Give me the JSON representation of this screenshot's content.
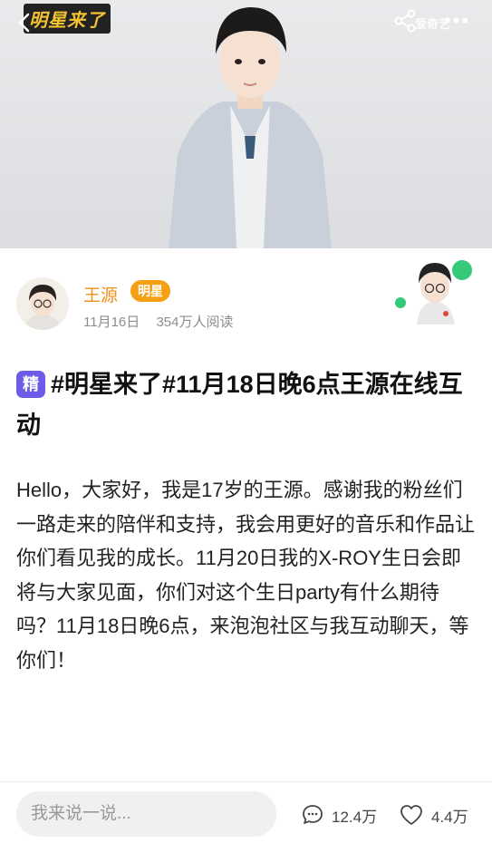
{
  "hero": {
    "logo_text": "明星来了",
    "brand": "爱奇艺",
    "more_glyph": "•••"
  },
  "author": {
    "name": "王源",
    "badge": "明星",
    "date": "11月16日",
    "reads": "354万人阅读"
  },
  "post": {
    "tag": "精",
    "title": "#明星来了#11月18日晚6点王源在线互动",
    "body": "Hello，大家好，我是17岁的王源。感谢我的粉丝们一路走来的陪伴和支持，我会用更好的音乐和作品让你们看见我的成长。11月20日我的X-ROY生日会即将与大家见面，你们对这个生日party有什么期待吗？11月18日晚6点，来泡泡社区与我互动聊天，等你们！"
  },
  "footer": {
    "comment_placeholder": "我来说一说...",
    "comments_count": "12.4万",
    "likes_count": "4.4万"
  },
  "colors": {
    "accent_orange": "#f4a012",
    "name_orange": "#f08f1a",
    "jing_purple": "#6c5ce7"
  }
}
